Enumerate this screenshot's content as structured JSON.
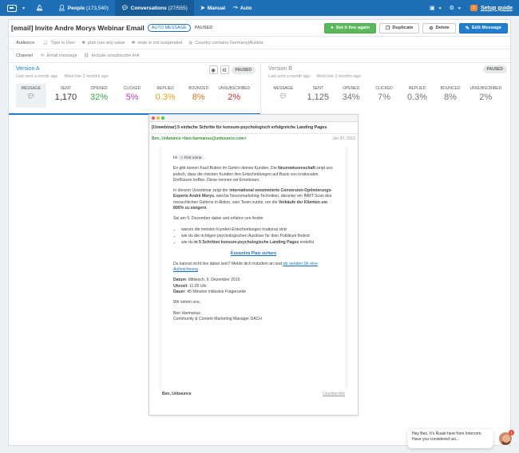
{
  "nav": {
    "people_label": "People",
    "people_count": "(173,540)",
    "conversations_label": "Conversations",
    "conversations_count": "(27/555)",
    "manual_label": "Manual",
    "auto_label": "Auto",
    "badge": "1",
    "setup_label": "Setup guide"
  },
  "header": {
    "title": "[email] Invite Andre Morys Webinar Email",
    "auto_badge": "AUTO MESSAGE",
    "status": "PAUSED",
    "btn_live": "Set it live again",
    "btn_duplicate": "Duplicate",
    "btn_delete": "Delete",
    "btn_edit": "Edit Message"
  },
  "audience": {
    "label": "Audience",
    "filters": [
      "Type is User",
      "plan has any value",
      "state is not suspended",
      "Country contains Germany|Austria"
    ]
  },
  "channel": {
    "label": "Channel",
    "items": [
      "Email message",
      "Include unsubscribe link"
    ]
  },
  "versions": [
    {
      "title": "Version A",
      "sent_ago": "Last sent a month ago",
      "live_ago": "Went live 2 months ago",
      "status": "PAUSED",
      "stats": {
        "message": "MESSAGE",
        "sent": "1,170",
        "opened": "32%",
        "clicked": "5%",
        "replied": "0.3%",
        "bounced": "8%",
        "unsubscribed": "2%"
      }
    },
    {
      "title": "Version B",
      "sent_ago": "Last sent a month ago",
      "live_ago": "Went live 2 months ago",
      "status": "PAUSED",
      "stats": {
        "message": "MESSAGE",
        "sent": "1,125",
        "opened": "34%",
        "clicked": "7%",
        "replied": "0.3%",
        "bounced": "8%",
        "unsubscribed": "2%"
      }
    }
  ],
  "stat_labels": {
    "sent": "SENT",
    "opened": "OPENED",
    "clicked": "CLICKED",
    "replied": "REPLIED",
    "bounced": "BOUNCED",
    "unsubscribed": "UNSUBSCRIBED"
  },
  "stat_colors": {
    "sent": "#333333",
    "opened": "#3aa74a",
    "clicked": "#b93cc4",
    "replied": "#e0a21e",
    "bounced": "#d4752a",
    "unsubscribed": "#c9342c"
  },
  "email": {
    "subject": "[Unwebinar] 5 einfache Schritte für konsum-psychologisch erfolgreiche Landing Pages",
    "from": "Ben, Unbounce <ben.harmanus@unbounce.com>",
    "date": "Jan 20, 2016",
    "greeting": "Hi",
    "first_name_chip": "›› First name",
    "greeting_end": ",",
    "p1_a": "Es gibt keinen Kauf-Button im Gehirn deines Kunden. Die ",
    "p1_b": "Neurowissenschaft",
    "p1_c": " zeigt uns jedoch, dass die meisten Kunden ihre Entscheidungen auf Basis von irrationalen Einflüssen treffen. Diese nennen wir Emotionen.",
    "p2_a": "In diesem Unwebinar zeigt der ",
    "p2_b": "international renommierte Conversion-Optimierungs-Experte André Morys",
    "p2_c": ", welche Neuromarketing-Techniken, darunter ein fMRT Scan des menschlichen Gehirns in Aktion, sein Team nutzte, um die ",
    "p2_d": "Verkäufe der Klienten um 800% zu steigern",
    "p2_e": ".",
    "p3": "Sei am 9. Dezember dabei und erfahre von André:",
    "bullet1": "warum die meisten Kunden-Entscheidungen irrational sind",
    "bullet2": "wie du die richtigen psychologischen Auslöser für dein Publikum findest",
    "bullet3_a": "wie du ",
    "bullet3_b": "in 5 Schritten konsum-psychologische Landing Pages",
    "bullet3_c": " erstellst",
    "cta": "Kostenlos Platz sichern",
    "p4_a": "Du kannst nicht live dabei sein? Melde dich trotzdem an und ",
    "p4_b": "wir senden Dir eine Aufzeichnung",
    "p4_c": ".",
    "datum_label": "Datum",
    "datum_value": ": Mittwoch, 9. Dezember 2015",
    "uhrzeit_label": "Uhrzeit",
    "uhrzeit_value": ": 11.00 Uhr",
    "dauer_label": "Dauer",
    "dauer_value": ": 45 Minuten inklusive Fragerunde",
    "closing": "Wir sehen uns,",
    "sig_name": "Ben Harmanus",
    "sig_title": "Community & Content Marketing Manager DACH",
    "footer_from": "Ben, Unbounce",
    "unsubscribe": "Unsubscribe"
  },
  "chat": {
    "message": "Hey Ben, It's Ruairi here from Intercom.  Have you considered usi...",
    "count": "1"
  }
}
